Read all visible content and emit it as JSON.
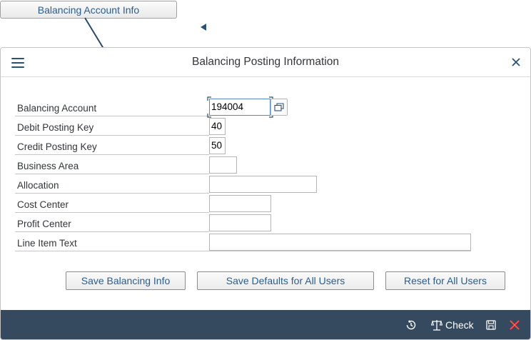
{
  "callout": {
    "label": "Balancing Account Info"
  },
  "dialog": {
    "title": "Balancing Posting Information",
    "fields": [
      {
        "label": "Balancing Account",
        "value": "194004"
      },
      {
        "label": "Debit Posting Key",
        "value": "40"
      },
      {
        "label": "Credit Posting Key",
        "value": "50"
      },
      {
        "label": "Business Area",
        "value": ""
      },
      {
        "label": "Allocation",
        "value": ""
      },
      {
        "label": "Cost Center",
        "value": ""
      },
      {
        "label": "Profit Center",
        "value": ""
      },
      {
        "label": "Line Item Text",
        "value": ""
      }
    ],
    "buttons": {
      "save_info": "Save Balancing Info",
      "save_defaults": "Save Defaults for All Users",
      "reset": "Reset for All Users"
    }
  },
  "footer": {
    "check_label": "Check"
  },
  "colors": {
    "footer_bg": "#354a5f",
    "link_text": "#2b5d8c",
    "close_red": "#d72b2b"
  }
}
